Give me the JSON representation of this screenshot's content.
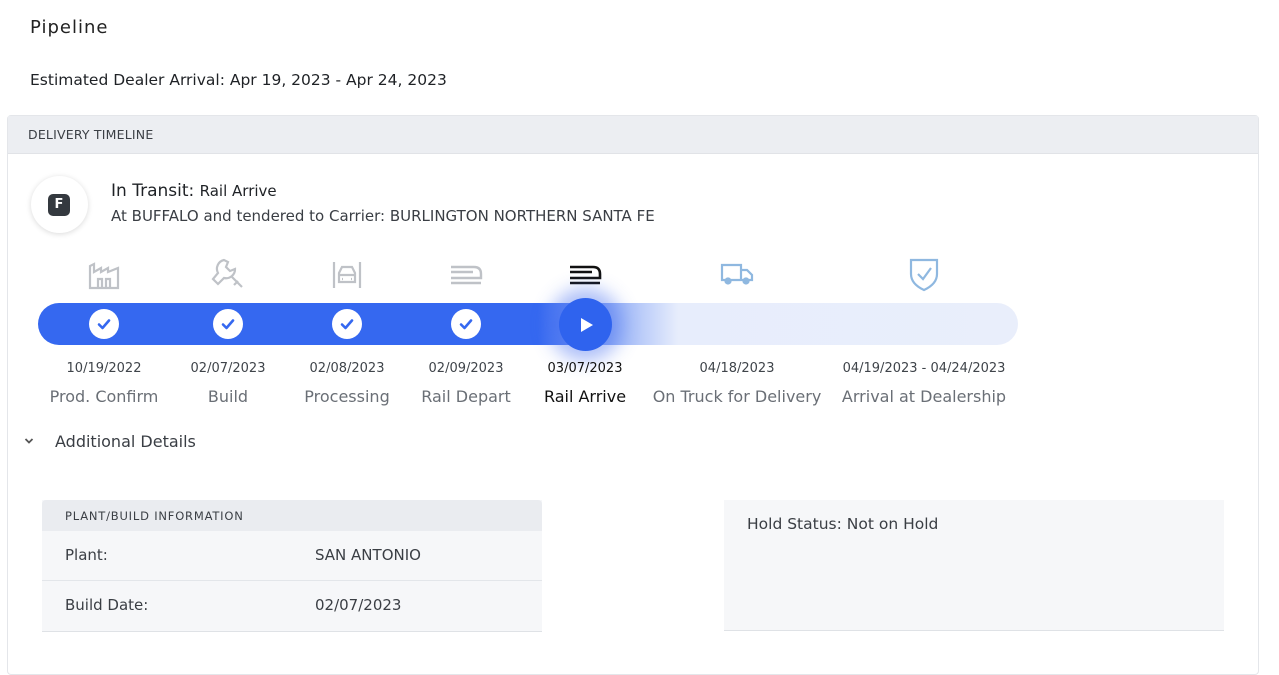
{
  "page": {
    "title": "Pipeline",
    "estimated_arrival": "Estimated Dealer Arrival: Apr 19, 2023 - Apr 24, 2023"
  },
  "timeline_card": {
    "header": "DELIVERY TIMELINE",
    "badge_letter": "F",
    "status_prefix": "In Transit:",
    "status_value": "Rail Arrive",
    "status_detail": "At BUFFALO and tendered to Carrier: BURLINGTON NORTHERN SANTA FE"
  },
  "steps": [
    {
      "date": "10/19/2022",
      "label": "Prod. Confirm",
      "icon": "factory-icon",
      "state": "complete"
    },
    {
      "date": "02/07/2023",
      "label": "Build",
      "icon": "wrench-icon",
      "state": "complete"
    },
    {
      "date": "02/08/2023",
      "label": "Processing",
      "icon": "car-wash-icon",
      "state": "complete"
    },
    {
      "date": "02/09/2023",
      "label": "Rail Depart",
      "icon": "train-icon",
      "state": "complete"
    },
    {
      "date": "03/07/2023",
      "label": "Rail Arrive",
      "icon": "train-icon",
      "state": "current"
    },
    {
      "date": "04/18/2023",
      "label": "On Truck for Delivery",
      "icon": "truck-icon",
      "state": "pending"
    },
    {
      "date": "04/19/2023 - 04/24/2023",
      "label": "Arrival at Dealership",
      "icon": "shield-check-icon",
      "state": "pending"
    }
  ],
  "colors": {
    "accent": "#3568f0",
    "complete_icon": "#bfc2c7",
    "current_icon": "#111111",
    "pending_icon": "#8fb8e0"
  },
  "details": {
    "toggle_label": "Additional Details",
    "plant_panel": {
      "header": "PLANT/BUILD INFORMATION",
      "rows": [
        {
          "key": "Plant:",
          "value": "SAN ANTONIO"
        },
        {
          "key": "Build Date:",
          "value": "02/07/2023"
        }
      ]
    },
    "hold_status": "Hold Status: Not on Hold"
  }
}
